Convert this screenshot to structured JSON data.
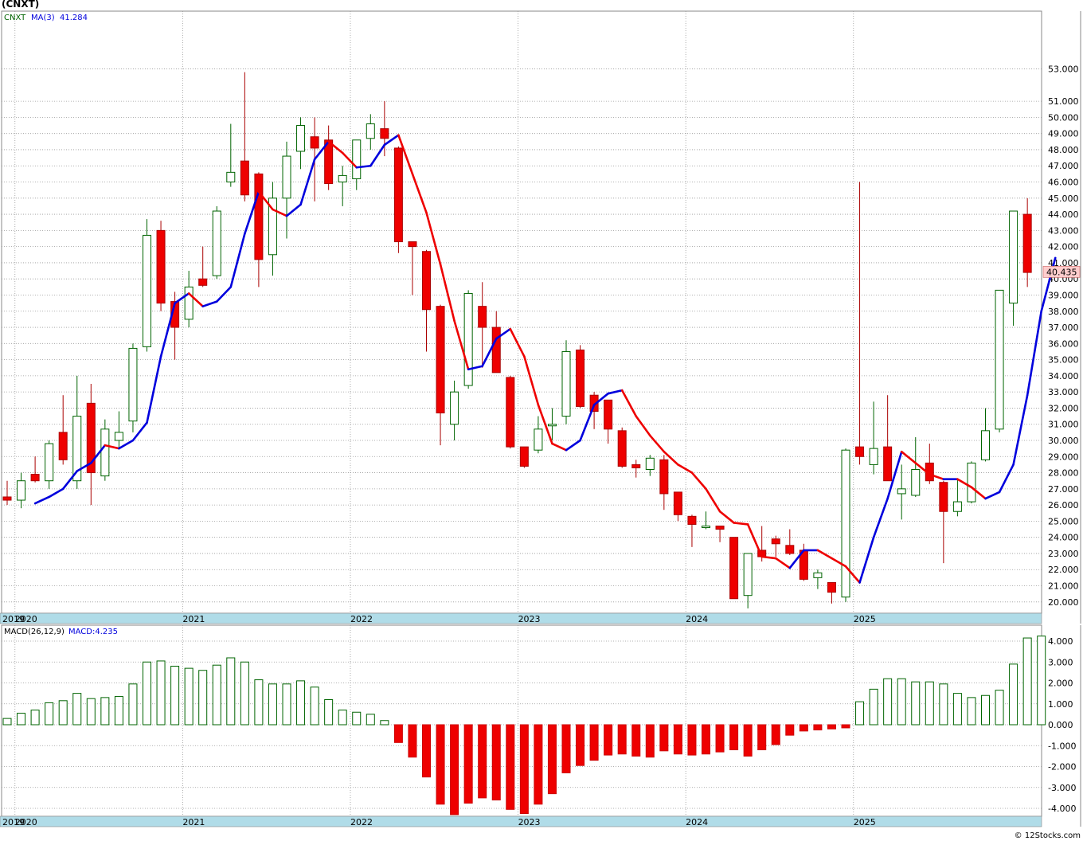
{
  "header": {
    "title": "(CNXT)"
  },
  "footer": {
    "copyright": "© 12Stocks.com"
  },
  "chart_data": [
    {
      "panel": "price",
      "type": "candlestick",
      "interval": "monthly",
      "symbol_label": "CNXT",
      "ma_label": "MA(3)",
      "ma_value_label": "41.284",
      "last_price_label": "40.435",
      "ylim": [
        19.5,
        54.0
      ],
      "y_ticks": [
        "20.000",
        "21.000",
        "22.000",
        "23.000",
        "24.000",
        "25.000",
        "26.000",
        "27.000",
        "28.000",
        "29.000",
        "30.000",
        "31.000",
        "32.000",
        "33.000",
        "34.000",
        "35.000",
        "36.000",
        "37.000",
        "38.000",
        "39.000",
        "40.000",
        "41.000",
        "42.000",
        "43.000",
        "44.000",
        "45.000",
        "46.000",
        "47.000",
        "48.000",
        "49.000",
        "50.000",
        "51.000",
        "53.000"
      ],
      "x_labels": [
        "2019",
        "2020",
        "2021",
        "2022",
        "2023",
        "2024",
        "2025"
      ],
      "grid": true,
      "colors": {
        "up": "#ffffff",
        "up_border": "#006400",
        "down": "#ee0000",
        "ma_up": "#0000dd",
        "ma_down": "#ee0000",
        "axis_bar": "#b0dce8"
      },
      "series": [
        {
          "date": "2019-12",
          "open": 26.5,
          "high": 27.5,
          "low": 26.0,
          "close": 26.3
        },
        {
          "date": "2020-01",
          "open": 26.3,
          "high": 28.0,
          "low": 25.8,
          "close": 27.5
        },
        {
          "date": "2020-02",
          "open": 27.9,
          "high": 29.0,
          "low": 27.4,
          "close": 27.5
        },
        {
          "date": "2020-03",
          "open": 27.5,
          "high": 30.0,
          "low": 27.0,
          "close": 29.8
        },
        {
          "date": "2020-04",
          "open": 30.5,
          "high": 32.8,
          "low": 28.5,
          "close": 28.8
        },
        {
          "date": "2020-05",
          "open": 27.5,
          "high": 34.0,
          "low": 27.0,
          "close": 31.5
        },
        {
          "date": "2020-06",
          "open": 32.3,
          "high": 33.5,
          "low": 26.0,
          "close": 28.0
        },
        {
          "date": "2020-07",
          "open": 27.8,
          "high": 31.3,
          "low": 27.5,
          "close": 30.7
        },
        {
          "date": "2020-08",
          "open": 30.0,
          "high": 31.8,
          "low": 29.5,
          "close": 30.5
        },
        {
          "date": "2020-09",
          "open": 31.2,
          "high": 36.0,
          "low": 30.5,
          "close": 35.7
        },
        {
          "date": "2020-10",
          "open": 35.8,
          "high": 43.7,
          "low": 35.5,
          "close": 42.7
        },
        {
          "date": "2020-11",
          "open": 43.0,
          "high": 43.6,
          "low": 38.0,
          "close": 38.5
        },
        {
          "date": "2020-12",
          "open": 38.6,
          "high": 39.2,
          "low": 35.0,
          "close": 37.0
        },
        {
          "date": "2021-01",
          "open": 37.5,
          "high": 40.5,
          "low": 37.0,
          "close": 39.5
        },
        {
          "date": "2021-02",
          "open": 40.0,
          "high": 42.0,
          "low": 39.5,
          "close": 39.6
        },
        {
          "date": "2021-03",
          "open": 40.2,
          "high": 44.5,
          "low": 40.0,
          "close": 44.2
        },
        {
          "date": "2021-04",
          "open": 46.0,
          "high": 49.6,
          "low": 45.7,
          "close": 46.6
        },
        {
          "date": "2021-05",
          "open": 47.3,
          "high": 52.8,
          "low": 44.8,
          "close": 45.2
        },
        {
          "date": "2021-06",
          "open": 46.5,
          "high": 46.6,
          "low": 39.5,
          "close": 41.2
        },
        {
          "date": "2021-07",
          "open": 41.5,
          "high": 46.0,
          "low": 40.2,
          "close": 45.0
        },
        {
          "date": "2021-08",
          "open": 45.0,
          "high": 48.5,
          "low": 42.5,
          "close": 47.6
        },
        {
          "date": "2021-09",
          "open": 47.9,
          "high": 50.0,
          "low": 46.8,
          "close": 49.5
        },
        {
          "date": "2021-10",
          "open": 48.8,
          "high": 50.0,
          "low": 44.8,
          "close": 48.1
        },
        {
          "date": "2021-11",
          "open": 48.6,
          "high": 49.5,
          "low": 45.5,
          "close": 45.9
        },
        {
          "date": "2021-12",
          "open": 46.0,
          "high": 47.0,
          "low": 44.5,
          "close": 46.4
        },
        {
          "date": "2022-01",
          "open": 46.2,
          "high": 48.6,
          "low": 45.5,
          "close": 48.6
        },
        {
          "date": "2022-02",
          "open": 48.7,
          "high": 50.2,
          "low": 48.0,
          "close": 49.6
        },
        {
          "date": "2022-03",
          "open": 49.3,
          "high": 51.0,
          "low": 47.6,
          "close": 48.7
        },
        {
          "date": "2022-04",
          "open": 48.1,
          "high": 48.2,
          "low": 41.6,
          "close": 42.3
        },
        {
          "date": "2022-05",
          "open": 42.3,
          "high": 42.3,
          "low": 39.0,
          "close": 42.0
        },
        {
          "date": "2022-06",
          "open": 41.7,
          "high": 41.8,
          "low": 35.5,
          "close": 38.1
        },
        {
          "date": "2022-07",
          "open": 38.3,
          "high": 38.4,
          "low": 29.7,
          "close": 31.7
        },
        {
          "date": "2022-08",
          "open": 31.0,
          "high": 33.7,
          "low": 30.0,
          "close": 33.0
        },
        {
          "date": "2022-09",
          "open": 33.4,
          "high": 39.3,
          "low": 33.2,
          "close": 39.1
        },
        {
          "date": "2022-10",
          "open": 38.3,
          "high": 39.8,
          "low": 34.5,
          "close": 37.0
        },
        {
          "date": "2022-11",
          "open": 37.0,
          "high": 38.0,
          "low": 34.2,
          "close": 34.2
        },
        {
          "date": "2022-12",
          "open": 33.9,
          "high": 34.0,
          "low": 29.5,
          "close": 29.6
        },
        {
          "date": "2023-01",
          "open": 29.6,
          "high": 29.6,
          "low": 28.3,
          "close": 28.4
        },
        {
          "date": "2023-02",
          "open": 29.4,
          "high": 31.5,
          "low": 29.2,
          "close": 30.7
        },
        {
          "date": "2023-03",
          "open": 30.9,
          "high": 32.0,
          "low": 30.0,
          "close": 31.0
        },
        {
          "date": "2023-04",
          "open": 31.5,
          "high": 36.2,
          "low": 31.0,
          "close": 35.5
        },
        {
          "date": "2023-05",
          "open": 35.6,
          "high": 35.9,
          "low": 32.0,
          "close": 32.1
        },
        {
          "date": "2023-06",
          "open": 32.8,
          "high": 33.0,
          "low": 30.7,
          "close": 31.8
        },
        {
          "date": "2023-07",
          "open": 32.5,
          "high": 32.5,
          "low": 29.8,
          "close": 30.7
        },
        {
          "date": "2023-08",
          "open": 30.6,
          "high": 30.8,
          "low": 28.3,
          "close": 28.4
        },
        {
          "date": "2023-09",
          "open": 28.5,
          "high": 28.8,
          "low": 27.7,
          "close": 28.3
        },
        {
          "date": "2023-10",
          "open": 28.2,
          "high": 29.1,
          "low": 27.8,
          "close": 28.9
        },
        {
          "date": "2023-11",
          "open": 28.8,
          "high": 29.1,
          "low": 25.7,
          "close": 26.7
        },
        {
          "date": "2023-12",
          "open": 26.8,
          "high": 26.8,
          "low": 25.0,
          "close": 25.4
        },
        {
          "date": "2024-01",
          "open": 25.3,
          "high": 25.4,
          "low": 23.4,
          "close": 24.8
        },
        {
          "date": "2024-02",
          "open": 24.6,
          "high": 25.6,
          "low": 24.5,
          "close": 24.7
        },
        {
          "date": "2024-03",
          "open": 24.7,
          "high": 24.7,
          "low": 23.7,
          "close": 24.5
        },
        {
          "date": "2024-04",
          "open": 24.0,
          "high": 24.0,
          "low": 20.2,
          "close": 20.2
        },
        {
          "date": "2024-05",
          "open": 20.4,
          "high": 23.0,
          "low": 19.6,
          "close": 23.0
        },
        {
          "date": "2024-06",
          "open": 23.2,
          "high": 24.7,
          "low": 22.5,
          "close": 22.8
        },
        {
          "date": "2024-07",
          "open": 23.9,
          "high": 24.1,
          "low": 22.8,
          "close": 23.6
        },
        {
          "date": "2024-08",
          "open": 23.5,
          "high": 24.5,
          "low": 22.9,
          "close": 23.0
        },
        {
          "date": "2024-09",
          "open": 23.2,
          "high": 23.6,
          "low": 21.3,
          "close": 21.4
        },
        {
          "date": "2024-10",
          "open": 21.5,
          "high": 22.0,
          "low": 20.8,
          "close": 21.8
        },
        {
          "date": "2024-11",
          "open": 21.2,
          "high": 21.2,
          "low": 19.9,
          "close": 20.6
        },
        {
          "date": "2024-12",
          "open": 20.3,
          "high": 29.5,
          "low": 20.0,
          "close": 29.4
        },
        {
          "date": "2025-01",
          "open": 29.6,
          "high": 46.0,
          "low": 28.5,
          "close": 29.0
        },
        {
          "date": "2025-02",
          "open": 28.5,
          "high": 32.4,
          "low": 27.9,
          "close": 29.5
        },
        {
          "date": "2025-03",
          "open": 29.6,
          "high": 32.8,
          "low": 27.5,
          "close": 27.5
        },
        {
          "date": "2025-04",
          "open": 26.7,
          "high": 28.5,
          "low": 25.1,
          "close": 27.0
        },
        {
          "date": "2025-05",
          "open": 26.6,
          "high": 30.2,
          "low": 26.5,
          "close": 28.2
        },
        {
          "date": "2025-06",
          "open": 28.6,
          "high": 29.8,
          "low": 27.3,
          "close": 27.5
        },
        {
          "date": "2025-07",
          "open": 27.4,
          "high": 27.5,
          "low": 22.4,
          "close": 25.6
        },
        {
          "date": "2025-08",
          "open": 25.6,
          "high": 27.6,
          "low": 25.3,
          "close": 26.2
        },
        {
          "date": "2025-09",
          "open": 26.2,
          "high": 28.7,
          "low": 26.1,
          "close": 28.6
        },
        {
          "date": "2025-10",
          "open": 28.8,
          "high": 32.0,
          "low": 28.7,
          "close": 30.6
        },
        {
          "date": "2025-11",
          "open": 30.7,
          "high": 39.3,
          "low": 30.5,
          "close": 39.3
        },
        {
          "date": "2025-12",
          "open": 38.5,
          "high": 44.2,
          "low": 37.1,
          "close": 44.2
        },
        {
          "date": "2026-01",
          "open": 44.0,
          "high": 45.0,
          "low": 39.5,
          "close": 40.4
        }
      ],
      "ma": [
        null,
        null,
        26.1,
        26.5,
        27.0,
        28.1,
        28.6,
        29.7,
        29.5,
        30.0,
        31.1,
        35.2,
        38.5,
        39.1,
        38.3,
        38.6,
        39.5,
        42.8,
        45.4,
        44.3,
        43.9,
        44.6,
        47.4,
        48.5,
        47.8,
        46.9,
        47.0,
        48.3,
        48.9,
        46.5,
        44.1,
        40.9,
        37.4,
        34.4,
        34.6,
        36.3,
        36.9,
        35.2,
        32.2,
        29.8,
        29.4,
        30.0,
        32.2,
        32.9,
        33.1,
        31.5,
        30.3,
        29.3,
        28.5,
        28.0,
        27.0,
        25.6,
        24.9,
        24.8,
        22.8,
        22.7,
        22.1,
        23.2,
        23.2,
        22.7,
        22.2,
        21.2,
        24.0,
        26.4,
        29.3,
        28.6,
        27.9,
        27.6,
        27.6,
        27.1,
        26.4,
        26.8,
        28.5,
        32.8,
        38.0,
        41.3
      ]
    },
    {
      "panel": "indicator",
      "type": "bar",
      "label": "MACD(26,12,9)",
      "value_label": "MACD:4.235",
      "ylim": [
        -4.5,
        4.45
      ],
      "y_ticks": [
        "-4.000",
        "-3.000",
        "-2.000",
        "-1.000",
        "0.000",
        "1.000",
        "2.000",
        "3.000",
        "4.000"
      ],
      "x_labels": [
        "2019",
        "2020",
        "2021",
        "2022",
        "2023",
        "2024",
        "2025"
      ],
      "colors": {
        "positive": "#ffffff",
        "positive_border": "#006400",
        "negative": "#ee0000"
      },
      "values": [
        0.3,
        0.55,
        0.7,
        1.05,
        1.15,
        1.5,
        1.25,
        1.3,
        1.35,
        1.95,
        3.0,
        3.05,
        2.8,
        2.7,
        2.6,
        2.85,
        3.2,
        3.0,
        2.15,
        1.95,
        1.95,
        2.1,
        1.8,
        1.2,
        0.7,
        0.6,
        0.5,
        0.2,
        -0.85,
        -1.55,
        -2.5,
        -3.8,
        -4.3,
        -3.75,
        -3.5,
        -3.6,
        -4.05,
        -4.25,
        -3.8,
        -3.3,
        -2.3,
        -1.95,
        -1.7,
        -1.45,
        -1.4,
        -1.5,
        -1.55,
        -1.25,
        -1.4,
        -1.45,
        -1.4,
        -1.3,
        -1.2,
        -1.5,
        -1.2,
        -0.95,
        -0.5,
        -0.3,
        -0.25,
        -0.2,
        -0.15,
        1.1,
        1.7,
        2.2,
        2.2,
        2.05,
        2.05,
        1.95,
        1.5,
        1.3,
        1.4,
        1.65,
        2.9,
        4.15,
        4.24
      ]
    }
  ]
}
